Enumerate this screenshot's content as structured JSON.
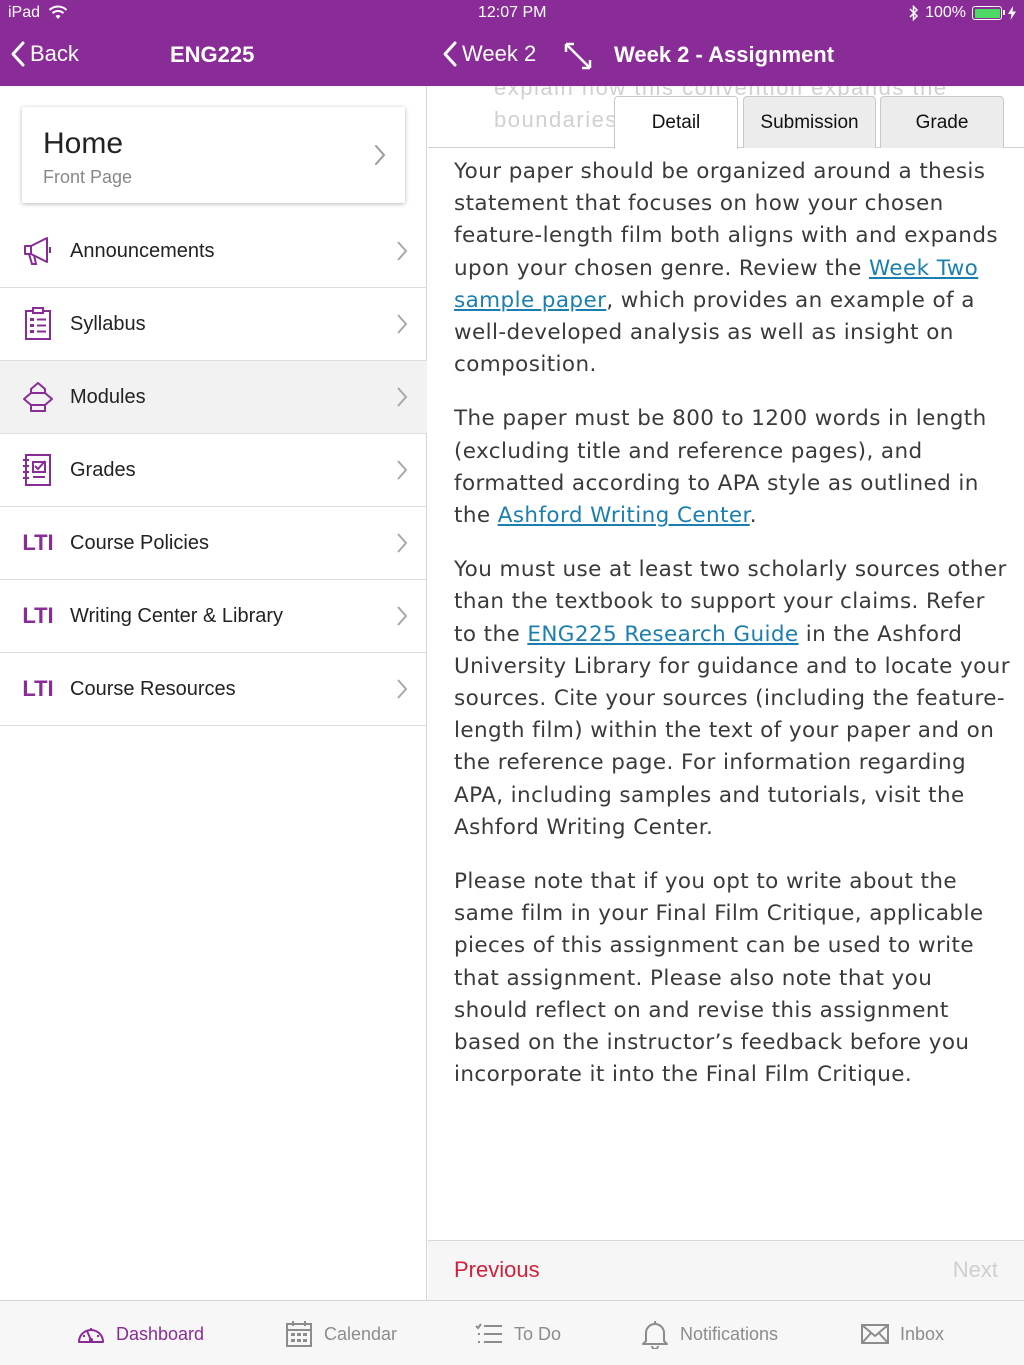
{
  "status_bar": {
    "device": "iPad",
    "time": "12:07 PM",
    "battery": "100%"
  },
  "header": {
    "back_label": "Back",
    "course_title": "ENG225",
    "week_back_label": "Week 2",
    "detail_title": "Week 2 - Assignment"
  },
  "sidebar": {
    "home": {
      "title": "Home",
      "subtitle": "Front Page"
    },
    "items": [
      {
        "label": "Announcements",
        "icon": "megaphone-icon"
      },
      {
        "label": "Syllabus",
        "icon": "syllabus-icon"
      },
      {
        "label": "Modules",
        "icon": "modules-icon",
        "selected": true
      },
      {
        "label": "Grades",
        "icon": "grades-icon"
      },
      {
        "label": "Course Policies",
        "icon": "lti-icon",
        "icon_text": "LTI"
      },
      {
        "label": "Writing Center & Library",
        "icon": "lti-icon",
        "icon_text": "LTI"
      },
      {
        "label": "Course Resources",
        "icon": "lti-icon",
        "icon_text": "LTI"
      }
    ]
  },
  "detail": {
    "ghost_line_1": "explain how this convention expands the",
    "ghost_line_2": "boundaries",
    "tabs": [
      {
        "label": "Detail",
        "active": true
      },
      {
        "label": "Submission",
        "active": false
      },
      {
        "label": "Grade",
        "active": false
      }
    ],
    "p1": {
      "before": "Your paper should be organized around a thesis statement that focuses on how your chosen feature-length film both aligns with and expands upon your chosen genre. Review the ",
      "link": "Week Two sample paper",
      "after": ", which provides an example of a well-developed analysis as well as insight on composition."
    },
    "p2": {
      "before": "The paper must be 800 to 1200 words in length (excluding title and reference pages), and formatted according to APA style as outlined in the ",
      "link": "Ashford Writing Center",
      "after": "."
    },
    "p3": {
      "before": "You must use at least two scholarly sources other than the textbook to support your claims. Refer to the ",
      "link": "ENG225 Research Guide",
      "after": " in the Ashford University Library for guidance and to locate your sources. Cite your sources (including the feature-length film) within the text of your paper and on the reference page. For information regarding APA, including samples and tutorials, visit the Ashford Writing Center."
    },
    "p4": "Please note that if you opt to write about the same film in your Final Film Critique, applicable pieces of this assignment can be used to write that assignment. Please also note that you should reflect on and revise this assignment based on the instructor’s feedback before you incorporate it into the Final Film Critique.",
    "previous_label": "Previous",
    "next_label": "Next"
  },
  "bottom_tabs": [
    {
      "label": "Dashboard",
      "icon": "dashboard-icon",
      "active": true
    },
    {
      "label": "Calendar",
      "icon": "calendar-icon",
      "active": false
    },
    {
      "label": "To Do",
      "icon": "todo-icon",
      "active": false
    },
    {
      "label": "Notifications",
      "icon": "bell-icon",
      "active": false
    },
    {
      "label": "Inbox",
      "icon": "inbox-icon",
      "active": false
    }
  ],
  "colors": {
    "brand": "#8a2c98",
    "link": "#1a7fb0",
    "previous": "#d0213b",
    "battery": "#4cd964"
  }
}
